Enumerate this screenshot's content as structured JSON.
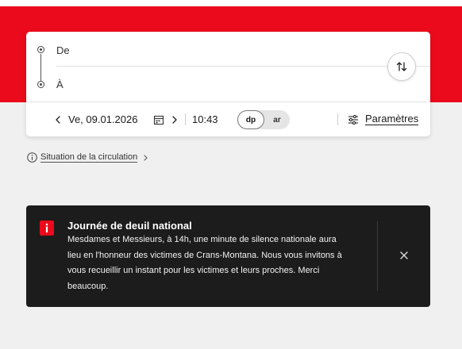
{
  "search": {
    "from_placeholder": "De",
    "to_placeholder": "À"
  },
  "datetime": {
    "date": "Ve, 09.01.2026",
    "time": "10:43"
  },
  "mode_toggle": {
    "options": [
      {
        "label": "dp",
        "selected": true
      },
      {
        "label": "ar",
        "selected": false
      }
    ]
  },
  "params": {
    "label": "Paramètres"
  },
  "traffic_link": {
    "label": "Situation de la circulation"
  },
  "notice": {
    "title": "Journée de deuil national",
    "lines": [
      "Mesdames et Messieurs, à 14h, une minute de silence nationale aura",
      "lieu en l'honneur des victimes de Crans-Montana. Nous vous invitons à",
      "vous recueillir un instant pour les victimes et leurs proches. Merci",
      "beaucoup."
    ]
  },
  "icons": {
    "swap": "swap-vertical-icon",
    "calendar": "calendar-icon",
    "settings": "sliders-icon",
    "info": "info-circle-icon",
    "alert": "alert-icon",
    "close": "close-icon"
  },
  "colors": {
    "brand_red": "#eb0a1b",
    "notice_background": "#1c1c1c",
    "page_background": "#f0f0f0"
  }
}
